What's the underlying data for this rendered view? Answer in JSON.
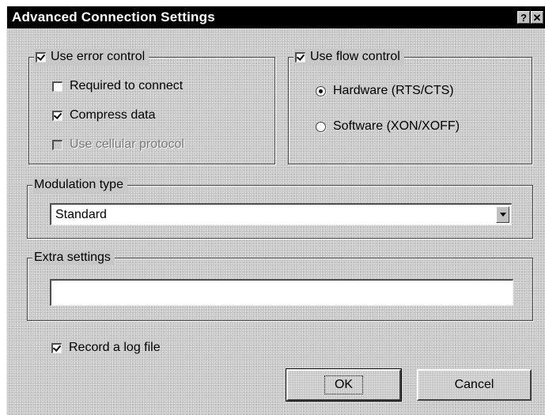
{
  "window": {
    "title": "Advanced Connection Settings",
    "help_glyph": "?",
    "close_glyph": "✕"
  },
  "error_control": {
    "label": "Use error control",
    "checked": true,
    "options": [
      {
        "label": "Required to connect",
        "checked": false,
        "enabled": true
      },
      {
        "label": "Compress data",
        "checked": true,
        "enabled": true
      },
      {
        "label": "Use cellular protocol",
        "checked": false,
        "enabled": false
      }
    ]
  },
  "flow_control": {
    "label": "Use flow control",
    "checked": true,
    "options": [
      {
        "label": "Hardware (RTS/CTS)",
        "selected": true
      },
      {
        "label": "Software (XON/XOFF)",
        "selected": false
      }
    ]
  },
  "modulation": {
    "label": "Modulation type",
    "value": "Standard"
  },
  "extra_settings": {
    "label": "Extra settings",
    "value": ""
  },
  "log_file": {
    "label": "Record a log file",
    "checked": true
  },
  "buttons": {
    "ok": "OK",
    "cancel": "Cancel"
  },
  "colors": {
    "dialog_bg": "#c8c8c8",
    "titlebar_bg": "#000000",
    "titlebar_text": "#ffffff"
  },
  "icons": {
    "help": "help-icon",
    "close": "close-icon",
    "dropdown": "chevron-down-icon"
  }
}
